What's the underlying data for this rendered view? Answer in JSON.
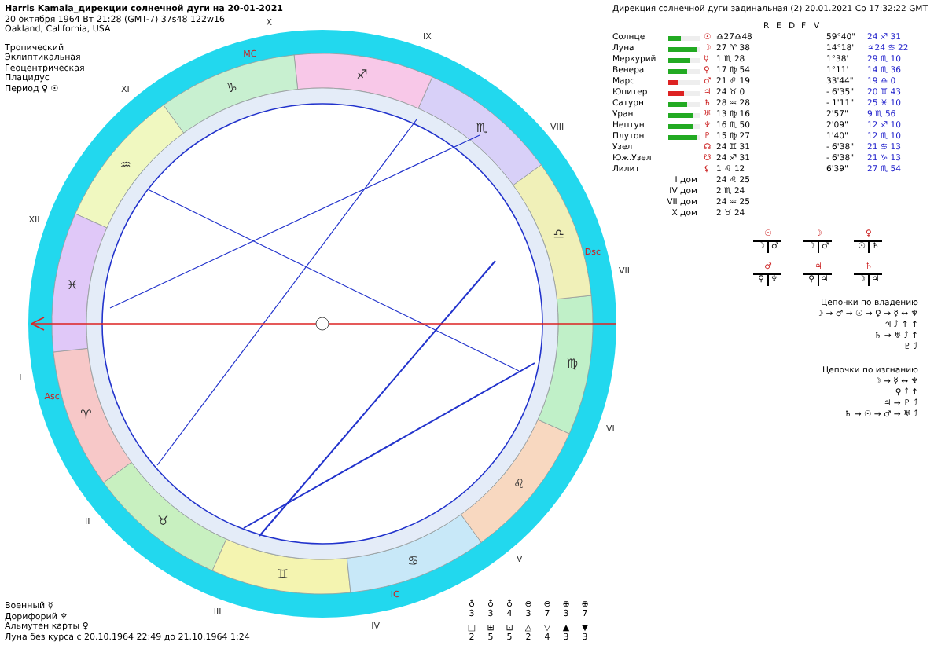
{
  "header": {
    "title": "Harris Kamala_дирекции солнечной дуги на 20-01-2021",
    "date": "20 октября 1964  Вт  21:28 (GMT-7) 37s48  122w16",
    "place": "Oakland, California, USA",
    "settings": [
      "Тропический",
      "Эклиптикальная",
      "Геоцентрическая",
      "Плацидус",
      "Период ♀ ☉"
    ]
  },
  "wheel": {
    "signs": [
      "♈",
      "♉",
      "♊",
      "♋",
      "♌",
      "♍",
      "♎",
      "♏",
      "♐",
      "♑",
      "♒",
      "♓"
    ],
    "houses": [
      "I",
      "II",
      "III",
      "IV",
      "V",
      "VI",
      "VII",
      "VIII",
      "IX",
      "X",
      "XI",
      "XII"
    ],
    "angles": [
      "Asc",
      "IC",
      "Dsc",
      "MC"
    ]
  },
  "table": {
    "title": "Дирекция солнечной дуги задинальная (2) 20.01.2021  Ср 17:32:22 GMT",
    "columns": [
      "R",
      "E",
      "D",
      "F",
      "V"
    ],
    "rows": [
      {
        "name": "Солнце",
        "level": 0.4,
        "color": "#22aa22",
        "glyph": "☉",
        "position": "♎27♎48",
        "speed": "59°40\"",
        "directed": "24 ♐ 31"
      },
      {
        "name": "Луна",
        "level": 0.9,
        "color": "#22aa22",
        "glyph": "☽",
        "position": "27 ♈ 38",
        "speed": "14°18'",
        "directed": "♃24 ♋ 22"
      },
      {
        "name": "Меркурий",
        "level": 0.7,
        "color": "#22aa22",
        "glyph": "☿",
        "position": "1 ♏ 28",
        "speed": "1°38'",
        "directed": "29 ♏ 10"
      },
      {
        "name": "Венера",
        "level": 0.6,
        "color": "#22aa22",
        "glyph": "♀",
        "position": "17 ♍ 54",
        "speed": "1°11'",
        "directed": "14 ♏ 36"
      },
      {
        "name": "Марс",
        "level": 0.3,
        "color": "#dd2222",
        "glyph": "♂",
        "position": "21 ♌ 19",
        "speed": "33'44\"",
        "directed": "19 ♎ 0"
      },
      {
        "name": "Юпитер",
        "level": 0.5,
        "color": "#dd2222",
        "glyph": "♃",
        "position": "24 ♉ 0",
        "speed": "- 6'35\"",
        "directed": "20 ♊ 43"
      },
      {
        "name": "Сатурн",
        "level": 0.6,
        "color": "#22aa22",
        "glyph": "♄",
        "position": "28 ♒ 28",
        "speed": "- 1'11\"",
        "directed": "25 ♓ 10"
      },
      {
        "name": "Уран",
        "level": 0.8,
        "color": "#22aa22",
        "glyph": "♅",
        "position": "13 ♍ 16",
        "speed": "2'57\"",
        "directed": "9 ♏ 56"
      },
      {
        "name": "Нептун",
        "level": 0.8,
        "color": "#22aa22",
        "glyph": "♆",
        "position": "16 ♏ 50",
        "speed": "2'09\"",
        "directed": "12 ♐ 10"
      },
      {
        "name": "Плутон",
        "level": 0.9,
        "color": "#22aa22",
        "glyph": "♇",
        "position": "15 ♍ 27",
        "speed": "1'40\"",
        "directed": "12 ♏ 10"
      },
      {
        "name": "Узел",
        "glyph": "☊",
        "position": "24 ♊ 31",
        "speed": "- 6'38\"",
        "directed": "21 ♋ 13"
      },
      {
        "name": "Юж.Узел",
        "glyph": "☋",
        "position": "24 ♐ 31",
        "speed": "- 6'38\"",
        "directed": "21 ♑ 13"
      },
      {
        "name": "Лилит",
        "glyph": "⚸",
        "position": "1 ♌ 12",
        "speed": "6'39\"",
        "directed": "27 ♏ 54"
      }
    ],
    "houses": [
      {
        "name": "I дом",
        "position": "24 ♌ 25"
      },
      {
        "name": "IV дом",
        "position": "2 ♏ 24"
      },
      {
        "name": "VII дом",
        "position": "24 ♒ 25"
      },
      {
        "name": "X дом",
        "position": "2 ♉ 24"
      }
    ]
  },
  "trees": [
    {
      "root": "☉",
      "left": "☽",
      "right": "♂"
    },
    {
      "root": "☽",
      "left": "☽",
      "right": "♂"
    },
    {
      "root": "♀",
      "left": "☉",
      "right": "♄"
    },
    {
      "root": "♂",
      "left": "♀",
      "right": "♆"
    },
    {
      "root": "♃",
      "left": "♀",
      "right": "♃"
    },
    {
      "root": "♄",
      "left": "☽",
      "right": "♃"
    }
  ],
  "chains": [
    {
      "title": "Цепочки по владению",
      "lines": [
        "☽ → ♂ → ☉ → ♀ → ☿ ↔ ♆",
        "♃ ⤴  ↑  ↑",
        "♄ → ♅ ⤴  ↑",
        "♇ ⤴"
      ]
    },
    {
      "title": "Цепочки по изгнанию",
      "lines": [
        "☽ → ☿ ↔ ♆",
        "♀ ⤴  ↑",
        "♃ → ♇ ⤴",
        "♄ → ☉ → ♂ → ♅ ⤴"
      ]
    }
  ],
  "footer": [
    "Военный ☿",
    "Дорифорий ♆",
    "Альмутен карты ♀",
    "Луна без курса с 20.10.1964 22:49 до 21.10.1964  1:24"
  ],
  "counts": [
    [
      {
        "glyph": "♁",
        "count": "3"
      },
      {
        "glyph": "♁",
        "count": "3"
      },
      {
        "glyph": "♁",
        "count": "4"
      },
      {
        "glyph": "⊖",
        "count": "3"
      },
      {
        "glyph": "⊖",
        "count": "7"
      },
      {
        "glyph": "⊕",
        "count": "3"
      },
      {
        "glyph": "⊕",
        "count": "7"
      }
    ],
    [
      {
        "glyph": "□",
        "count": "2"
      },
      {
        "glyph": "⊞",
        "count": "5"
      },
      {
        "glyph": "⊡",
        "count": "5"
      },
      {
        "glyph": "△",
        "count": "2"
      },
      {
        "glyph": "▽",
        "count": "4"
      },
      {
        "glyph": "▲",
        "count": "3"
      },
      {
        "glyph": "▼",
        "count": "3"
      }
    ]
  ]
}
